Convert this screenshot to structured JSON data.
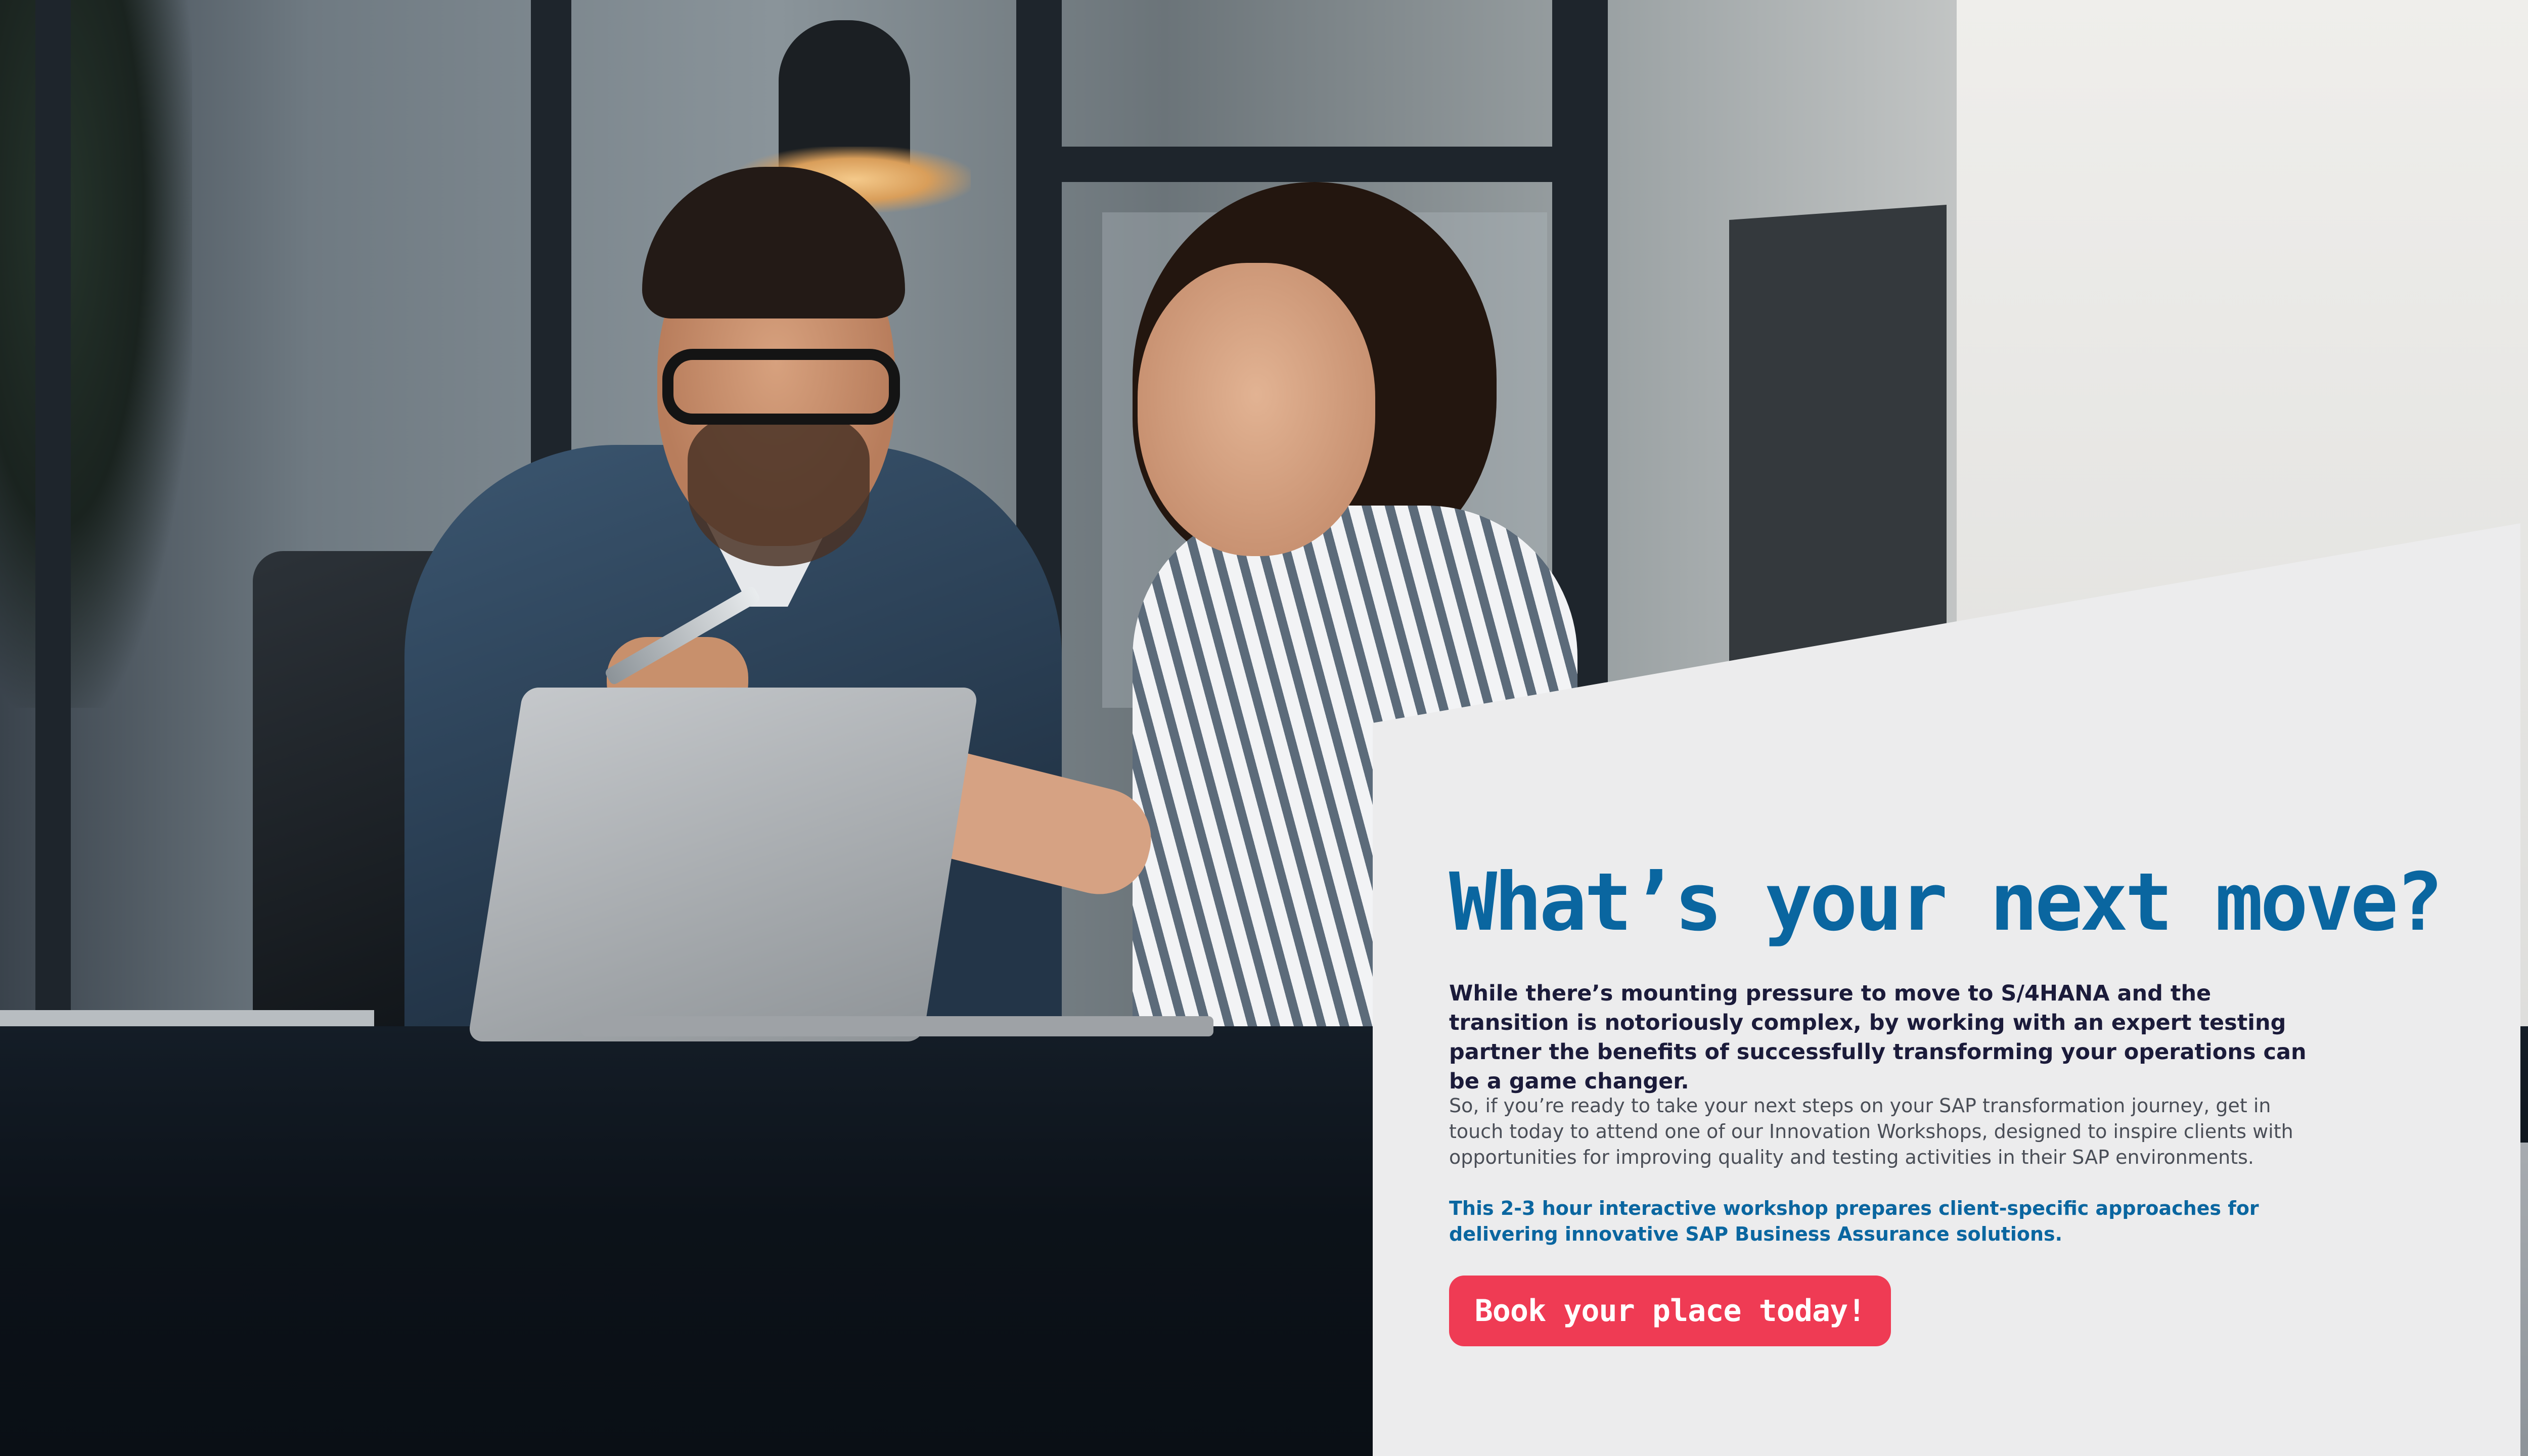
{
  "hero": {
    "image": "photo-two-colleagues-laptop"
  },
  "panel": {
    "headline": "What’s your next move?",
    "lead": "While there’s mounting pressure to move to S/4HANA and the transition is notoriously complex, by working with an expert testing partner the benefits of successfully transforming your operations can be a game changer.",
    "body": "So, if you’re ready to take your next steps on your SAP transformation journey, get in touch today to attend one of our Innovation Workshops, designed to inspire clients with opportunities for improving quality and testing activities in their SAP environments.",
    "highlight": "This 2-3 hour interactive workshop prepares client-specific approaches for delivering innovative SAP Business Assurance solutions.",
    "cta_label": "Book your place today!"
  },
  "colors": {
    "accent_blue": "#0a66a0",
    "cta_red": "#ef3b54",
    "panel_bg": "#ececed",
    "lead_text": "#1b1b3a"
  }
}
